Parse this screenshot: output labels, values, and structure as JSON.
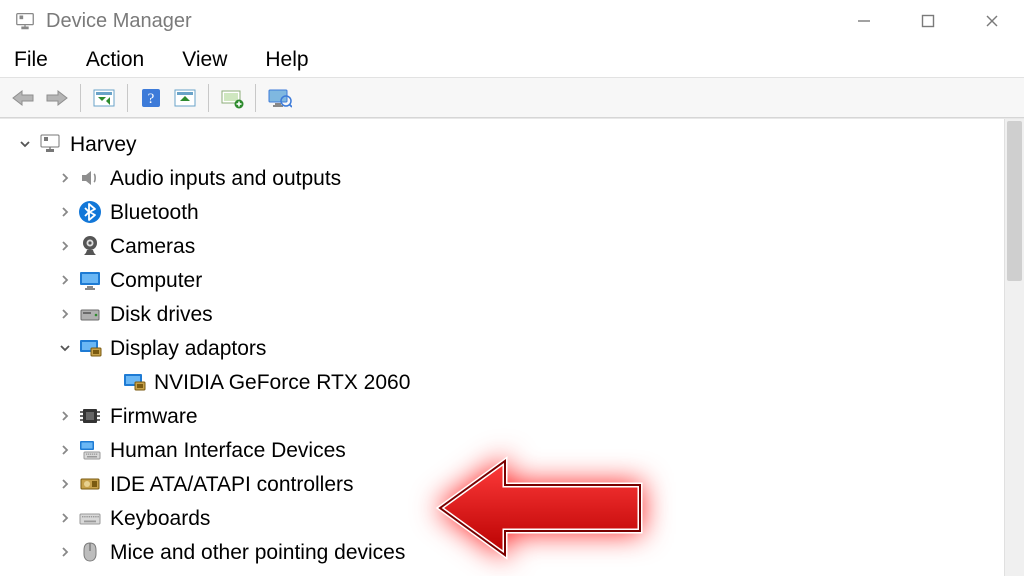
{
  "window": {
    "title": "Device Manager"
  },
  "menubar": {
    "file": "File",
    "action": "Action",
    "view": "View",
    "help": "Help"
  },
  "tree": {
    "root": "Harvey",
    "audio": "Audio inputs and outputs",
    "bluetooth": "Bluetooth",
    "cameras": "Cameras",
    "computer": "Computer",
    "disk": "Disk drives",
    "display": "Display adaptors",
    "gpu": "NVIDIA GeForce RTX 2060",
    "firmware": "Firmware",
    "hid": "Human Interface Devices",
    "ide": "IDE ATA/ATAPI controllers",
    "keyboards": "Keyboards",
    "mice": "Mice and other pointing devices"
  }
}
